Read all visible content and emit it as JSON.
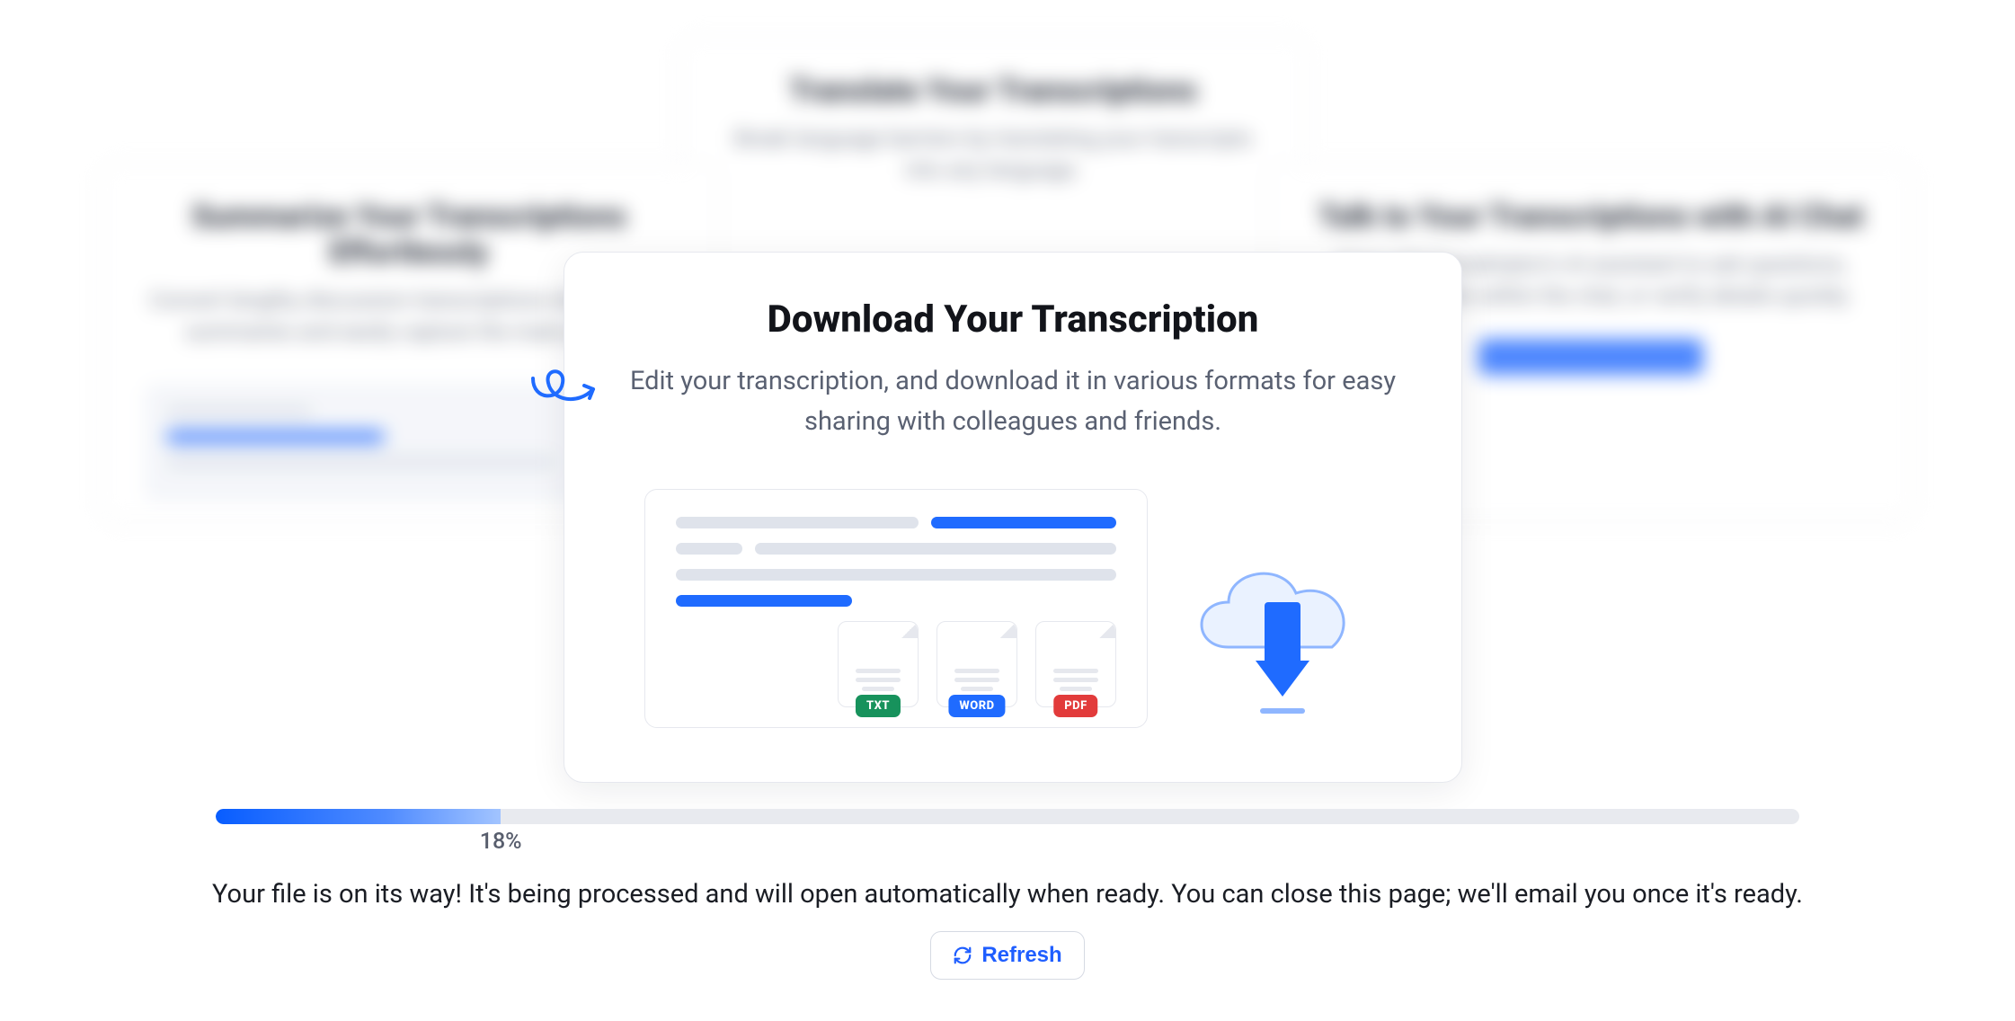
{
  "background_cards": {
    "left": {
      "title": "Summarize Your Transcriptions Effortlessly",
      "desc": "Convert lengthy discussion transcriptions into concise summaries and easily capture the main points."
    },
    "top": {
      "title": "Translate Your Transcriptions",
      "desc": "Break language barriers by translating your transcripts into any language."
    },
    "right": {
      "title": "Talk to Your Transcriptions with AI Chat",
      "desc": "Chat with Transkriptor's AI assistant to ask questions, look for details within the chat, or verify details quickly."
    }
  },
  "feature": {
    "title": "Download Your Transcription",
    "subtitle": "Edit your transcription, and download it in various formats for easy sharing with colleagues and friends.",
    "formats": {
      "txt": "TXT",
      "word": "WORD",
      "pdf": "PDF"
    }
  },
  "progress": {
    "percent": 18,
    "label": "18%"
  },
  "status_message": "Your file is on its way! It's being processed and will open automatically when ready. You can close this page; we'll email you once it's ready.",
  "refresh": {
    "label": "Refresh"
  }
}
